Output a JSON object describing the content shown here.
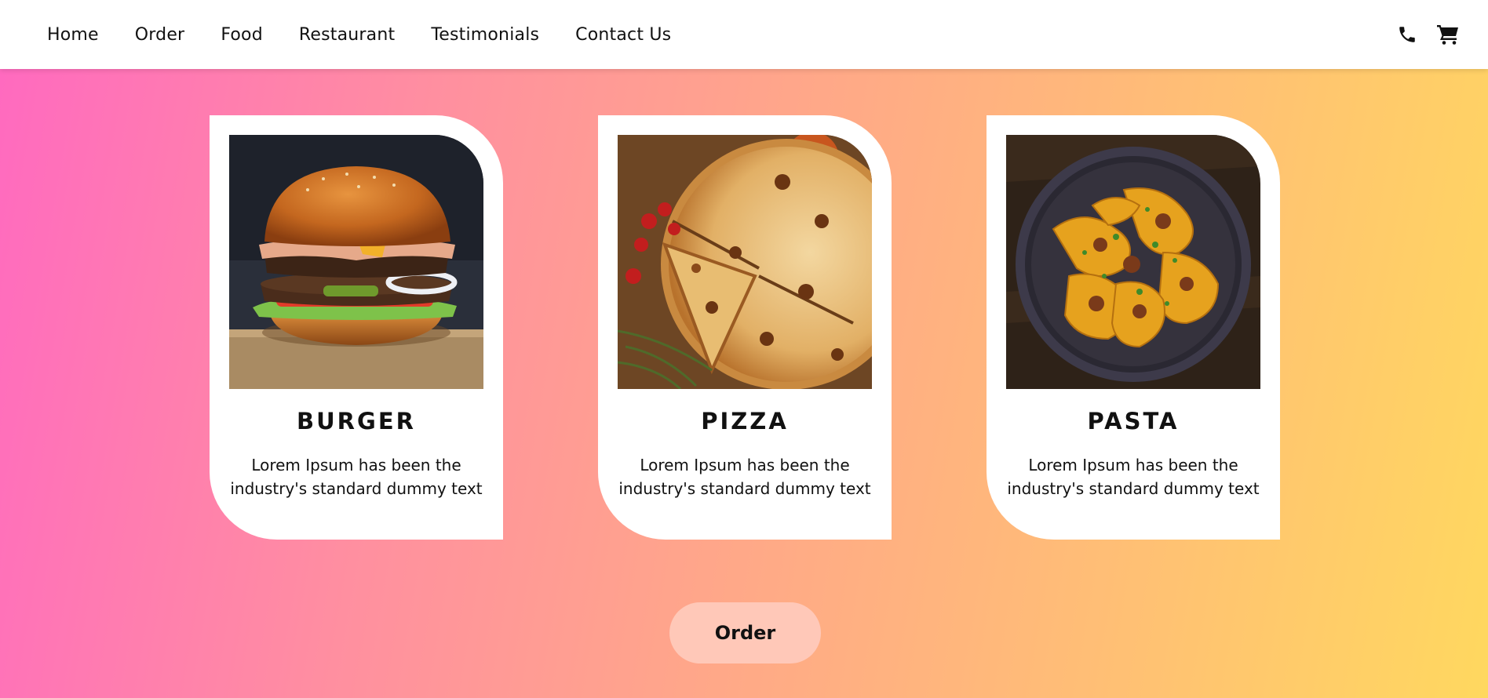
{
  "nav": {
    "links": [
      "Home",
      "Order",
      "Food",
      "Restaurant",
      "Testimonials",
      "Contact Us"
    ],
    "icons": [
      "phone-icon",
      "cart-icon"
    ]
  },
  "cards": [
    {
      "title": "BURGER",
      "description": "Lorem Ipsum has been the industry's standard dummy text",
      "image": "burger-photo"
    },
    {
      "title": "PIZZA",
      "description": "Lorem Ipsum has been the industry's standard dummy text",
      "image": "pizza-photo"
    },
    {
      "title": "PASTA",
      "description": "Lorem Ipsum has been the industry's standard dummy text",
      "image": "pasta-photo"
    }
  ],
  "order_button": {
    "label": "Order"
  },
  "colors": {
    "gradient_start": "#ff69c0",
    "gradient_end": "#ffd85f",
    "button_bg": "#ffc8b8",
    "card_bg": "#ffffff"
  }
}
